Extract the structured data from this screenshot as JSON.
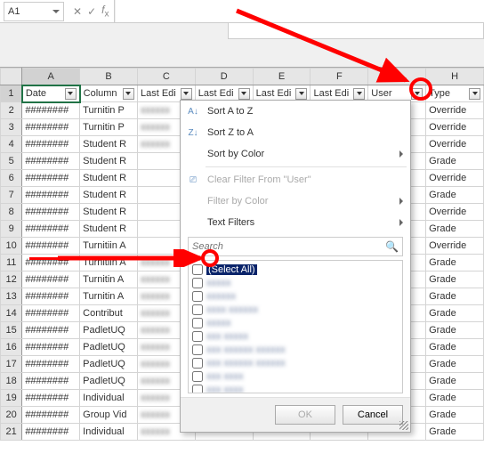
{
  "formula": {
    "nameBox": "A1",
    "value": "Date"
  },
  "columns": [
    "A",
    "B",
    "C",
    "D",
    "E",
    "F",
    "G",
    "H"
  ],
  "headers": [
    "Date",
    "Column",
    "Last Edi",
    "Last Edi",
    "Last Edi",
    "Last Edi",
    "User",
    "Type"
  ],
  "rows": [
    {
      "n": "1"
    },
    {
      "n": "2",
      "a": "########",
      "b": "Turnitin P",
      "c": "blur",
      "h": "Override"
    },
    {
      "n": "3",
      "a": "########",
      "b": "Turnitin P",
      "c": "blur",
      "h": "Override"
    },
    {
      "n": "4",
      "a": "########",
      "b": "Student R",
      "c": "blur",
      "h": "Override"
    },
    {
      "n": "5",
      "a": "########",
      "b": "Student R",
      "c": "",
      "h": "Grade"
    },
    {
      "n": "6",
      "a": "########",
      "b": "Student R",
      "c": "",
      "h": "Override"
    },
    {
      "n": "7",
      "a": "########",
      "b": "Student R",
      "c": "",
      "h": "Grade"
    },
    {
      "n": "8",
      "a": "########",
      "b": "Student R",
      "c": "",
      "h": "Override"
    },
    {
      "n": "9",
      "a": "########",
      "b": "Student R",
      "c": "",
      "h": "Grade"
    },
    {
      "n": "10",
      "a": "########",
      "b": "Turnitiin A",
      "c": "",
      "h": "Override"
    },
    {
      "n": "11",
      "a": "########",
      "b": "Turnitiin A",
      "c": "blur",
      "h": "Grade"
    },
    {
      "n": "12",
      "a": "########",
      "b": "Turnitin A",
      "c": "blur",
      "h": "Grade"
    },
    {
      "n": "13",
      "a": "########",
      "b": "Turnitin A",
      "c": "blur",
      "h": "Grade"
    },
    {
      "n": "14",
      "a": "########",
      "b": "Contribut",
      "c": "blur",
      "h": "Grade"
    },
    {
      "n": "15",
      "a": "########",
      "b": "PadletUQ",
      "c": "blur",
      "h": "Grade"
    },
    {
      "n": "16",
      "a": "########",
      "b": "PadletUQ",
      "c": "blur",
      "h": "Grade"
    },
    {
      "n": "17",
      "a": "########",
      "b": "PadletUQ",
      "c": "blur",
      "h": "Grade"
    },
    {
      "n": "18",
      "a": "########",
      "b": "PadletUQ",
      "c": "blur",
      "h": "Grade"
    },
    {
      "n": "19",
      "a": "########",
      "b": "Individual",
      "c": "blur",
      "h": "Grade"
    },
    {
      "n": "20",
      "a": "########",
      "b": "Group Vid",
      "c": "blur",
      "h": "Grade"
    },
    {
      "n": "21",
      "a": "########",
      "b": "Individual",
      "c": "blur",
      "h": "Grade"
    }
  ],
  "menu": {
    "sortAZ": "Sort A to Z",
    "sortZA": "Sort Z to A",
    "sortColor": "Sort by Color",
    "clearFilter": "Clear Filter From \"User\"",
    "filterColor": "Filter by Color",
    "textFilters": "Text Filters",
    "searchPlaceholder": "Search",
    "selectAll": "(Select All)",
    "ok": "OK",
    "cancel": "Cancel",
    "blurItems": [
      "xxxxx",
      "xxxxxx",
      "xxxx xxxxxx",
      "xxxxx",
      "xxx xxxxx",
      "xxx xxxxxx xxxxxx",
      "xxx xxxxxx xxxxxx",
      "xxx xxxx",
      "xxx xxxx"
    ]
  }
}
